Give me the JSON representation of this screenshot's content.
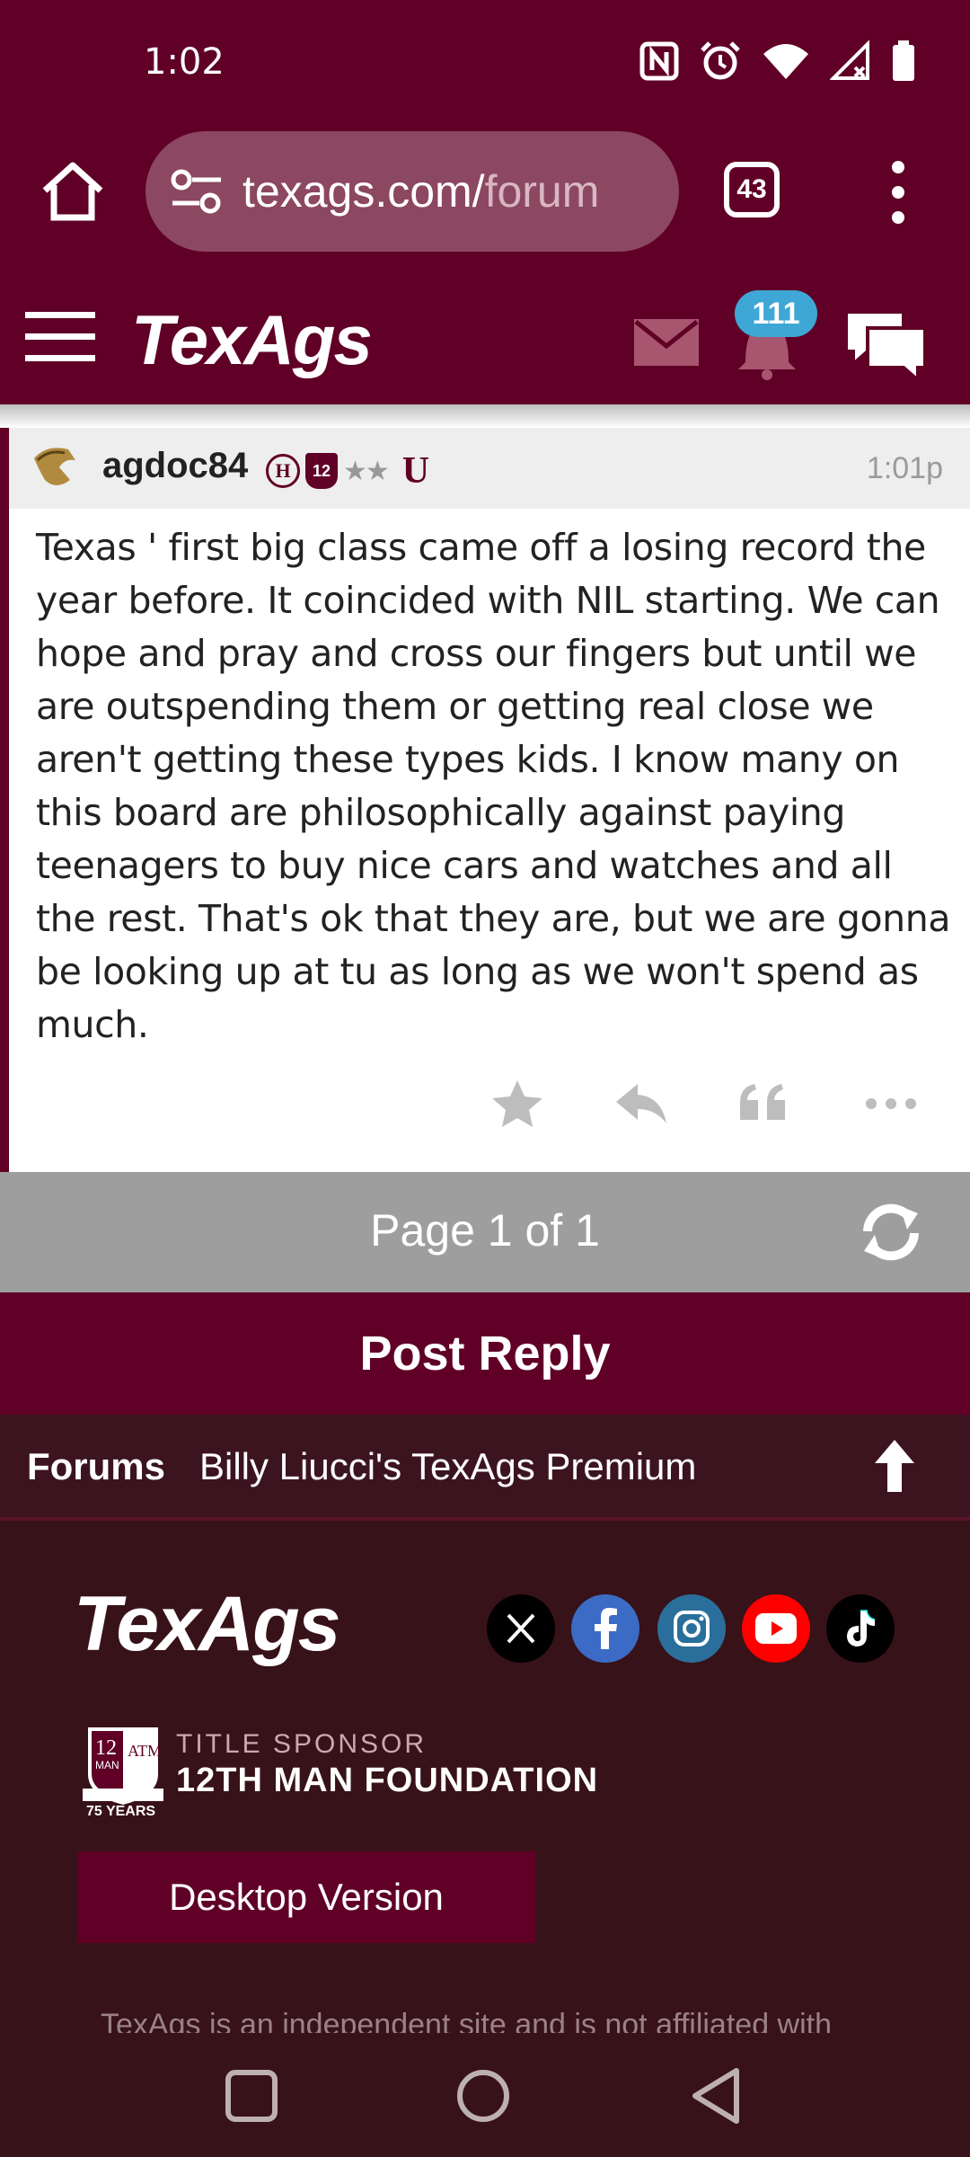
{
  "status": {
    "time": "1:02",
    "icons": [
      "nfc-icon",
      "alarm-icon",
      "wifi-icon",
      "signal-icon",
      "battery-icon"
    ]
  },
  "browser": {
    "url_main": "texags.com/",
    "url_dim": "forum",
    "tab_count": "43"
  },
  "header": {
    "logo": "TexAgs",
    "notification_count": "111"
  },
  "post": {
    "username": "agdoc84",
    "badge_h": "H",
    "badge_12": "12",
    "badge_stars": "★★",
    "badge_u": "U",
    "time": "1:01p",
    "body": "Texas ' first big class came off a losing record the year before. It coincided with NIL starting. We can hope and pray and cross our fingers but until we are outspending them or getting real close we aren't getting these types kids. I know many on this board are philosophically against paying teenagers to buy nice cars and watches and all the rest. That's ok that they are, but we are gonna be looking up at tu as long as we won't spend as much."
  },
  "pager": {
    "label": "Page 1 of 1"
  },
  "reply": {
    "label": "Post Reply"
  },
  "breadcrumb": {
    "forums": "Forums",
    "current": "Billy Liucci's TexAgs Premium"
  },
  "footer": {
    "logo": "TexAgs",
    "social": [
      "x-icon",
      "facebook-icon",
      "instagram-icon",
      "youtube-icon",
      "tiktok-icon"
    ],
    "sponsor_label": "TITLE SPONSOR",
    "sponsor_name": "12TH MAN FOUNDATION",
    "crest_years": "75 YEARS",
    "desktop_button": "Desktop Version",
    "disclaimer": "TexAgs is an independent site and is not affiliated with"
  },
  "colors": {
    "maroon": "#600026",
    "footer_bg": "#381219",
    "pager_bg": "#9e9e9e",
    "badge_blue": "#3fa7d6"
  }
}
